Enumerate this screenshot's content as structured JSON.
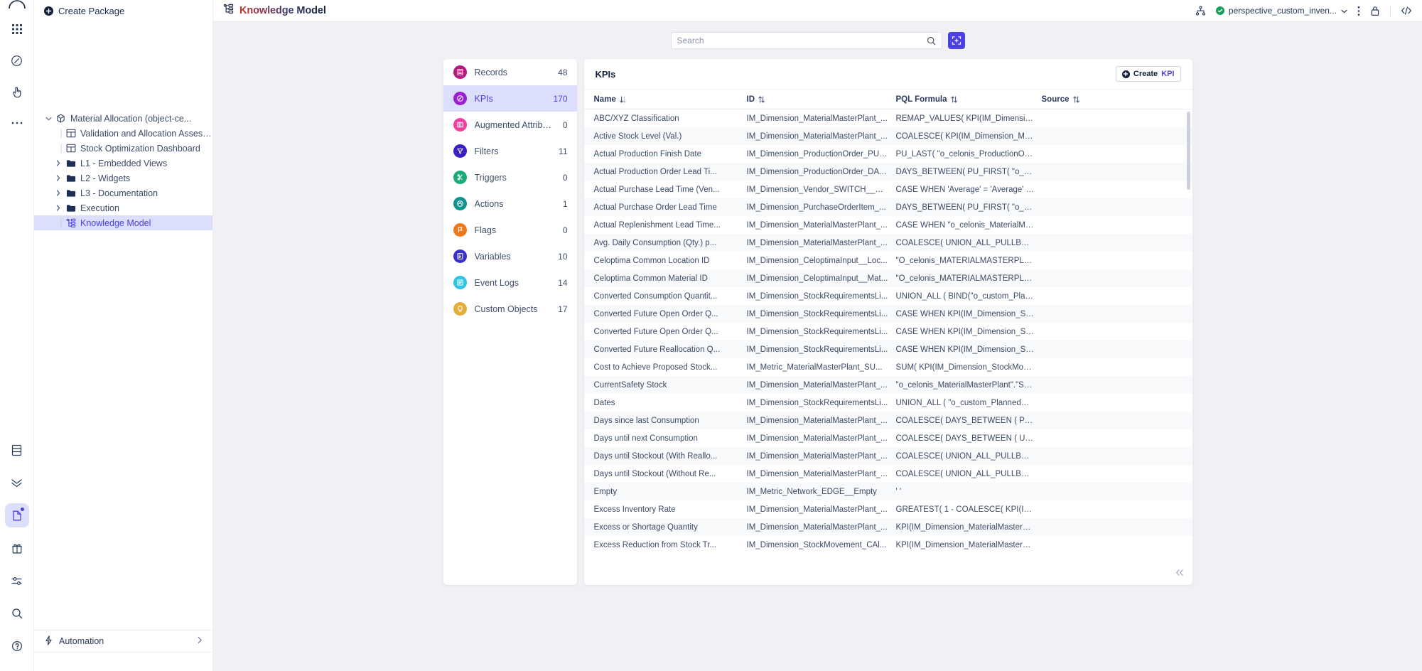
{
  "rail": {
    "top_icons": [
      {
        "name": "celonis-logo-icon"
      },
      {
        "name": "apps-grid-icon"
      },
      {
        "name": "compass-icon"
      },
      {
        "name": "hand-pointer-icon"
      },
      {
        "name": "more-horizontal-icon"
      }
    ],
    "bottom_icons": [
      {
        "name": "database-icon",
        "active": false
      },
      {
        "name": "merge-arrows-icon",
        "active": false
      },
      {
        "name": "package-icon",
        "active": true,
        "dot": true
      },
      {
        "name": "gift-icon",
        "active": false
      },
      {
        "name": "sliders-icon",
        "active": false
      },
      {
        "name": "search-icon",
        "active": false
      },
      {
        "name": "help-circle-icon",
        "active": false
      }
    ]
  },
  "sidebar": {
    "create_package": "Create Package",
    "tree": [
      {
        "label": "Material Allocation (object-ce...",
        "icon": "package-cube-icon",
        "caret": "down",
        "depth": 0,
        "selected": false
      },
      {
        "label": "Validation and Allocation Assess...",
        "icon": "view-table-icon",
        "caret": "none",
        "depth": 1,
        "selected": false
      },
      {
        "label": "Stock Optimization Dashboard",
        "icon": "view-table-icon",
        "caret": "none",
        "depth": 1,
        "selected": false
      },
      {
        "label": "L1 - Embedded Views",
        "icon": "folder-icon",
        "caret": "right",
        "depth": 1,
        "selected": false
      },
      {
        "label": "L2 - Widgets",
        "icon": "folder-icon",
        "caret": "right",
        "depth": 1,
        "selected": false
      },
      {
        "label": "L3 - Documentation",
        "icon": "folder-icon",
        "caret": "right",
        "depth": 1,
        "selected": false
      },
      {
        "label": "Execution",
        "icon": "folder-icon",
        "caret": "right",
        "depth": 1,
        "selected": false
      },
      {
        "label": "Knowledge Model",
        "icon": "knowledge-model-icon",
        "caret": "none",
        "depth": 1,
        "selected": true
      }
    ],
    "automation": "Automation"
  },
  "topbar": {
    "title": "Knowledge Model",
    "title_icon": "knowledge-model-icon",
    "hierarchy_icon": "hierarchy-icon",
    "space_name": "perspective_custom_inven...",
    "status_icon": "check-circle-icon",
    "chevron_icon": "chevron-down-icon",
    "more_icon": "more-vertical-icon",
    "lock_icon": "lock-icon",
    "code_icon": "code-brackets-icon"
  },
  "search": {
    "placeholder": "Search",
    "value": "",
    "icon": "search-icon",
    "action_icon": "expand-selection-icon"
  },
  "categories": [
    {
      "label": "Records",
      "count": "48",
      "color": "#b5197e",
      "icon": "records-icon",
      "active": false
    },
    {
      "label": "KPIs",
      "count": "170",
      "color": "#9b1fd1",
      "icon": "kpi-compass-icon",
      "active": true
    },
    {
      "label": "Augmented Attributes",
      "count": "0",
      "color": "#f23fa0",
      "icon": "augmented-attributes-icon",
      "active": false
    },
    {
      "label": "Filters",
      "count": "11",
      "color": "#3a1fc4",
      "icon": "funnel-icon",
      "active": false
    },
    {
      "label": "Triggers",
      "count": "0",
      "color": "#1aa97a",
      "icon": "trigger-icon",
      "active": false
    },
    {
      "label": "Actions",
      "count": "1",
      "color": "#12918f",
      "icon": "actions-icon",
      "active": false
    },
    {
      "label": "Flags",
      "count": "0",
      "color": "#ea7a1b",
      "icon": "flag-icon",
      "active": false
    },
    {
      "label": "Variables",
      "count": "10",
      "color": "#3730c9",
      "icon": "variables-icon",
      "active": false
    },
    {
      "label": "Event Logs",
      "count": "14",
      "color": "#2cc4e0",
      "icon": "event-log-icon",
      "active": false
    },
    {
      "label": "Custom Objects",
      "count": "17",
      "color": "#e0b03a",
      "icon": "lightbulb-icon",
      "active": false
    }
  ],
  "table": {
    "title": "KPIs",
    "create_button": {
      "prefix": "Create",
      "suffix": "KPI",
      "icon": "plus-circle-icon"
    },
    "columns": [
      {
        "label": "Name",
        "sort": "desc"
      },
      {
        "label": "ID",
        "sort": "none"
      },
      {
        "label": "PQL Formula",
        "sort": "none"
      },
      {
        "label": "Source",
        "sort": "none"
      }
    ],
    "rows": [
      {
        "name": "ABC/XYZ Classification",
        "id": "IM_Dimension_MaterialMasterPlant_...",
        "pql": "REMAP_VALUES( KPI(IM_Dimension_...",
        "source": ""
      },
      {
        "name": "Active Stock Level (Val.)",
        "id": "IM_Dimension_MaterialMasterPlant_...",
        "pql": "COALESCE( KPI(IM_Dimension_Mate...",
        "source": ""
      },
      {
        "name": "Actual Production Finish Date",
        "id": "IM_Dimension_ProductionOrder_PUL...",
        "pql": "PU_LAST( \"o_celonis_ProductionOrd...",
        "source": ""
      },
      {
        "name": "Actual Production Order Lead Ti...",
        "id": "IM_Dimension_ProductionOrder_DAY...",
        "pql": "DAYS_BETWEEN( PU_FIRST( \"o_celo...",
        "source": ""
      },
      {
        "name": "Actual Purchase Lead Time (Ven...",
        "id": "IM_Dimension_Vendor_SWITCH__Act...",
        "pql": "CASE WHEN 'Average' = 'Average' T...",
        "source": ""
      },
      {
        "name": "Actual Purchase Order Lead Time",
        "id": "IM_Dimension_PurchaseOrderItem_...",
        "pql": "DAYS_BETWEEN( PU_FIRST( \"o_celo...",
        "source": ""
      },
      {
        "name": "Actual Replenishment Lead Time...",
        "id": "IM_Dimension_MaterialMasterPlant_...",
        "pql": "CASE WHEN \"o_celonis_MaterialMas...",
        "source": ""
      },
      {
        "name": "Avg. Daily Consumption (Qty.) p...",
        "id": "IM_Dimension_MaterialMasterPlant_...",
        "pql": "COALESCE( UNION_ALL_PULLBACK...",
        "source": ""
      },
      {
        "name": "Celoptima Common Location ID",
        "id": "IM_Dimension_CeloptimaInput__Loc...",
        "pql": "\"O_celonis_MATERIALMASTERPLAN...",
        "source": ""
      },
      {
        "name": "Celoptima Common Material ID",
        "id": "IM_Dimension_CeloptimaInput__Mat...",
        "pql": "\"O_celonis_MATERIALMASTERPLAN...",
        "source": ""
      },
      {
        "name": "Converted Consumption Quantit...",
        "id": "IM_Dimension_StockRequirementsLi...",
        "pql": "UNION_ALL ( BIND(\"o_custom_Plann...",
        "source": ""
      },
      {
        "name": "Converted Future Open Order Q...",
        "id": "IM_Dimension_StockRequirementsLi...",
        "pql": "CASE WHEN KPI(IM_Dimension_Sto...",
        "source": ""
      },
      {
        "name": "Converted Future Open Order Q...",
        "id": "IM_Dimension_StockRequirementsLi...",
        "pql": "CASE WHEN KPI(IM_Dimension_Sto...",
        "source": ""
      },
      {
        "name": "Converted Future Reallocation Q...",
        "id": "IM_Dimension_StockRequirementsLi...",
        "pql": "CASE WHEN KPI(IM_Dimension_Sto...",
        "source": ""
      },
      {
        "name": "Cost to Achieve Proposed Stock...",
        "id": "IM_Metric_MaterialMasterPlant_SU...",
        "pql": "SUM( KPI(IM_Dimension_StockMove...",
        "source": ""
      },
      {
        "name": "CurrentSafety Stock",
        "id": "IM_Dimension_MaterialMasterPlant_...",
        "pql": "\"o_celonis_MaterialMasterPlant\".\"Saf...",
        "source": ""
      },
      {
        "name": "Dates",
        "id": "IM_Dimension_StockRequirementsLi...",
        "pql": "UNION_ALL ( \"o_custom_PlannedOr...",
        "source": ""
      },
      {
        "name": "Days since last Consumption",
        "id": "IM_Dimension_MaterialMasterPlant_...",
        "pql": "COALESCE( DAYS_BETWEEN ( PU_L...",
        "source": ""
      },
      {
        "name": "Days until next Consumption",
        "id": "IM_Dimension_MaterialMasterPlant_...",
        "pql": "COALESCE( DAYS_BETWEEN ( UNIO...",
        "source": ""
      },
      {
        "name": "Days until Stockout (With Reallo...",
        "id": "IM_Dimension_MaterialMasterPlant_...",
        "pql": "COALESCE( UNION_ALL_PULLBACK...",
        "source": ""
      },
      {
        "name": "Days until Stockout (Without Re...",
        "id": "IM_Dimension_MaterialMasterPlant_...",
        "pql": "COALESCE( UNION_ALL_PULLBACK...",
        "source": ""
      },
      {
        "name": "Empty",
        "id": "IM_Metric_Network_EDGE__Empty",
        "pql": "' '",
        "source": ""
      },
      {
        "name": "Excess Inventory Rate",
        "id": "IM_Dimension_MaterialMasterPlant_...",
        "pql": "GREATEST( 1 - COALESCE( KPI(IM_...",
        "source": ""
      },
      {
        "name": "Excess or Shortage Quantity",
        "id": "IM_Dimension_MaterialMasterPlant_...",
        "pql": "KPI(IM_Dimension_MaterialMasterPl...",
        "source": ""
      },
      {
        "name": "Excess Reduction from Stock Tr...",
        "id": "IM_Dimension_StockMovement_CAl...",
        "pql": "KPI(IM_Dimension_MaterialMasterPl...",
        "source": ""
      }
    ],
    "collapse_icon": "chevrons-left-icon"
  }
}
